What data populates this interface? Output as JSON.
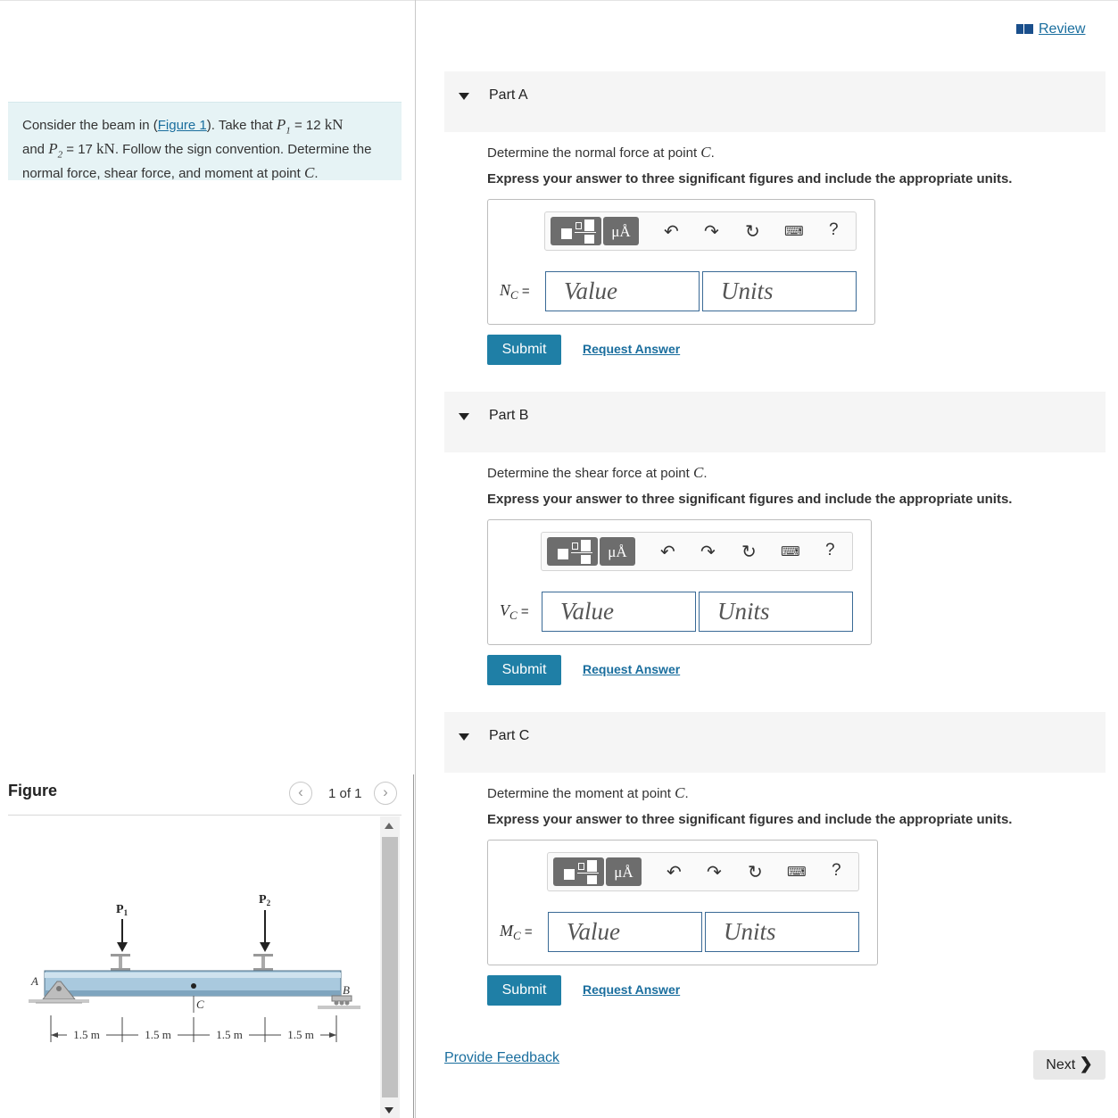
{
  "header": {
    "review_label": "Review"
  },
  "problem": {
    "text_1": "Consider the beam in (",
    "figure_link": "Figure 1",
    "text_2": "). Take that ",
    "p1_sym": "P",
    "p1_sub": "1",
    "eq_1": " = 12 ",
    "unit_1": "kN",
    "text_3": "and ",
    "p2_sym": "P",
    "p2_sub": "2",
    "eq_2": " = 17 ",
    "unit_2": "kN",
    "text_4": ". Follow the sign convention. Determine the normal force, shear force, and moment at point ",
    "point": "C",
    "end": "."
  },
  "figure": {
    "title": "Figure",
    "count": "1 of 1",
    "labels": {
      "p1": "P",
      "p1_sub": "1",
      "p2": "P",
      "p2_sub": "2",
      "a": "A",
      "b": "B",
      "c": "C",
      "dims": [
        "1.5 m",
        "1.5 m",
        "1.5 m",
        "1.5 m"
      ]
    }
  },
  "parts": [
    {
      "title": "Part A",
      "question_pre": "Determine the normal force at point ",
      "question_var": "C",
      "question_post": ".",
      "instruction": "Express your answer to three significant figures and include the appropriate units.",
      "var": "N",
      "var_sub": "C",
      "equals": " =",
      "value_placeholder": "Value",
      "units_placeholder": "Units",
      "submit": "Submit",
      "request": "Request Answer"
    },
    {
      "title": "Part B",
      "question_pre": "Determine the shear force at point ",
      "question_var": "C",
      "question_post": ".",
      "instruction": "Express your answer to three significant figures and include the appropriate units.",
      "var": "V",
      "var_sub": "C",
      "equals": " =",
      "value_placeholder": "Value",
      "units_placeholder": "Units",
      "submit": "Submit",
      "request": "Request Answer"
    },
    {
      "title": "Part C",
      "question_pre": "Determine the moment at point ",
      "question_var": "C",
      "question_post": ".",
      "instruction": "Express your answer to three significant figures and include the appropriate units.",
      "var": "M",
      "var_sub": "C",
      "equals": " =",
      "value_placeholder": "Value",
      "units_placeholder": "Units",
      "submit": "Submit",
      "request": "Request Answer"
    }
  ],
  "toolbar": {
    "mu_label": "μÅ",
    "help_label": "?"
  },
  "footer": {
    "feedback": "Provide Feedback",
    "next": "Next"
  }
}
